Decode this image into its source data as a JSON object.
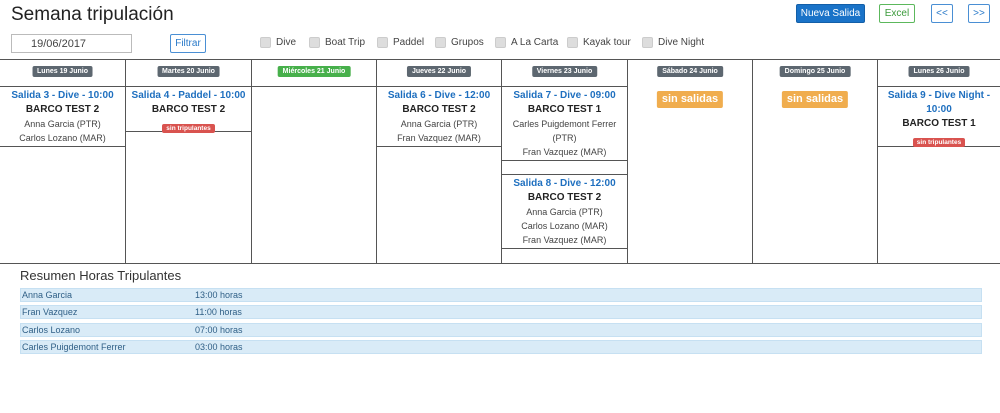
{
  "header": {
    "title": "Semana tripulación",
    "new_trip_label": "Nueva Salida",
    "excel_label": "Excel",
    "prev_label": "<<",
    "next_label": ">>"
  },
  "filters": {
    "date_value": "19/06/2017",
    "filter_button_label": "Filtrar",
    "activities": [
      "Dive",
      "Boat Trip",
      "Paddel",
      "Grupos",
      "A La Carta",
      "Kayak tour",
      "Dive Night"
    ]
  },
  "calendar": {
    "days": [
      {
        "label": "Lunes 19 Junio",
        "today": false
      },
      {
        "label": "Martes 20 Junio",
        "today": false
      },
      {
        "label": "Miércoles 21 Junio",
        "today": true
      },
      {
        "label": "Jueves 22 Junio",
        "today": false
      },
      {
        "label": "Viernes 23 Junio",
        "today": false
      },
      {
        "label": "Sábado 24 Junio",
        "today": false
      },
      {
        "label": "Domingo 25 Junio",
        "today": false
      },
      {
        "label": "Lunes 26 Junio",
        "today": false
      }
    ],
    "no_trips_label": "sin salidas",
    "no_crew_label": "sin tripulantes",
    "trips": {
      "mon19": {
        "title": "Salida 3 - Dive - 10:00",
        "boat": "BARCO TEST 2",
        "crew": [
          "Anna Garcia (PTR)",
          "Carlos Lozano (MAR)"
        ]
      },
      "tue20": {
        "title": "Salida 4 - Paddel - 10:00",
        "boat": "BARCO TEST 2"
      },
      "thu22": {
        "title": "Salida 6 - Dive - 12:00",
        "boat": "BARCO TEST 2",
        "crew": [
          "Anna Garcia (PTR)",
          "Fran Vazquez (MAR)"
        ]
      },
      "fri23a": {
        "title": "Salida 7 - Dive - 09:00",
        "boat": "BARCO TEST 1",
        "crew": [
          "Carles Puigdemont Ferrer",
          "(PTR)",
          "Fran Vazquez (MAR)"
        ]
      },
      "fri23b": {
        "title": "Salida 8 - Dive - 12:00",
        "boat": "BARCO TEST 2",
        "crew": [
          "Anna Garcia (PTR)",
          "Carlos Lozano (MAR)",
          "Fran Vazquez (MAR)"
        ]
      },
      "mon26": {
        "title_line1": "Salida 9 - Dive Night -",
        "title_line2": "10:00",
        "boat": "BARCO TEST 1"
      }
    }
  },
  "summary": {
    "title": "Resumen Horas Tripulantes",
    "rows": [
      {
        "name": "Anna Garcia",
        "hours": "13:00 horas"
      },
      {
        "name": "Fran Vazquez",
        "hours": "11:00 horas"
      },
      {
        "name": "Carlos Lozano",
        "hours": "07:00 horas"
      },
      {
        "name": "Carles Puigdemont Ferrer",
        "hours": "03:00 horas"
      }
    ]
  },
  "colors": {
    "primary": "#1a73c8",
    "trip_title": "#1e6fbf",
    "today_badge": "#47b04b",
    "day_badge": "#5d6770",
    "no_trips": "#f0ad4e",
    "no_crew": "#d9534f",
    "summary_row": "#d9ebf7"
  }
}
